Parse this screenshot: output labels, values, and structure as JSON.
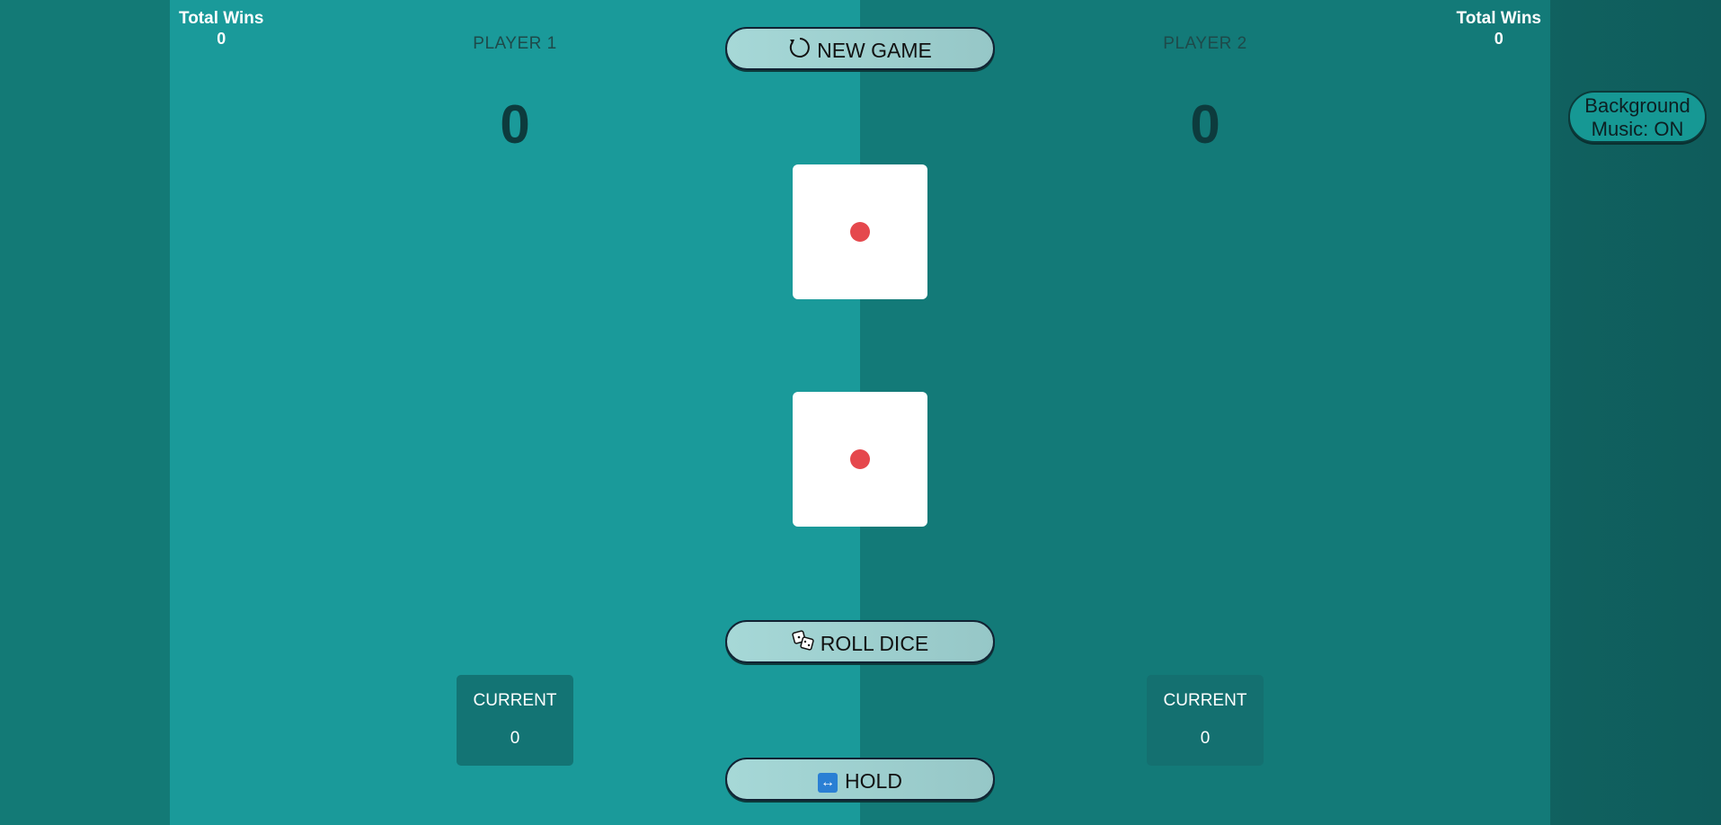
{
  "player1": {
    "name": "PLAYER 1",
    "score": "0",
    "current_label": "CURRENT",
    "current_value": "0",
    "wins_label": "Total Wins",
    "wins_value": "0"
  },
  "player2": {
    "name": "PLAYER 2",
    "score": "0",
    "current_label": "CURRENT",
    "current_value": "0",
    "wins_label": "Total Wins",
    "wins_value": "0"
  },
  "buttons": {
    "new_game": "NEW GAME",
    "roll_dice": "ROLL DICE",
    "hold": "HOLD"
  },
  "music_button": {
    "line1": "Background",
    "line2": "Music: ON"
  },
  "dice": [
    {
      "value": 1
    },
    {
      "value": 1
    }
  ],
  "icons": {
    "new_game": "refresh-icon",
    "roll_dice": "dice-icon",
    "hold": "left-right-arrow-icon"
  },
  "colors": {
    "player1_bg": "#1a9a9a",
    "player2_bg": "#137a78",
    "pip": "#e5484d",
    "button_bg": "#a6d8d7"
  }
}
